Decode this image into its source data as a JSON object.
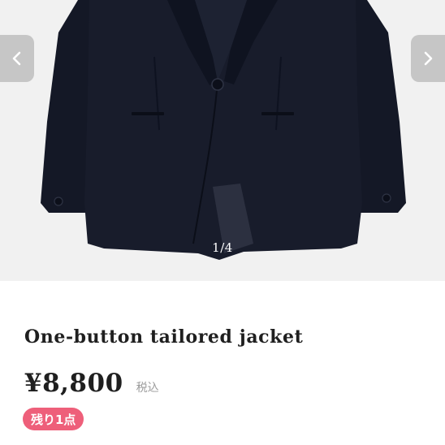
{
  "gallery": {
    "image_alt": "",
    "counter": "1/4"
  },
  "product": {
    "title": "One-button tailored jacket",
    "price": "¥8,800",
    "tax_label": "税込",
    "stock_badge": "残り1点"
  },
  "colors": {
    "jacket": "#161a28",
    "badge": "#ee5f7a",
    "nav_button": "#bebebe"
  }
}
